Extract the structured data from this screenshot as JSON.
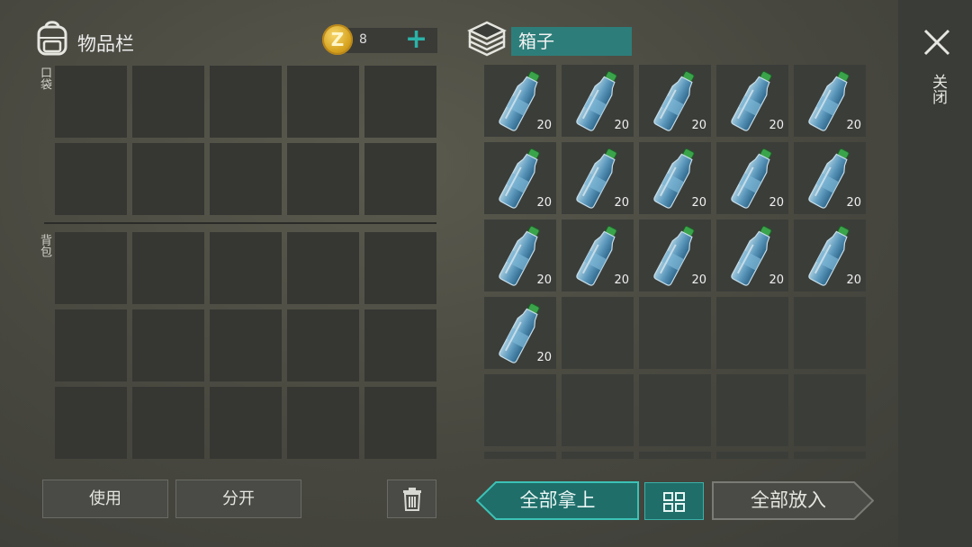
{
  "inventory": {
    "title": "物品栏",
    "pocket_label": "口袋",
    "backpack_label": "背包",
    "coin_icon": "Z",
    "coins": "8",
    "use_label": "使用",
    "split_label": "分开"
  },
  "box": {
    "name": "箱子",
    "item_qty": "20",
    "items": [
      {
        "qty": "20"
      },
      {
        "qty": "20"
      },
      {
        "qty": "20"
      },
      {
        "qty": "20"
      },
      {
        "qty": "20"
      },
      {
        "qty": "20"
      },
      {
        "qty": "20"
      },
      {
        "qty": "20"
      },
      {
        "qty": "20"
      },
      {
        "qty": "20"
      },
      {
        "qty": "20"
      },
      {
        "qty": "20"
      },
      {
        "qty": "20"
      },
      {
        "qty": "20"
      },
      {
        "qty": "20"
      },
      {
        "qty": "20"
      }
    ],
    "take_all_label": "全部拿上",
    "put_all_label": "全部放入"
  },
  "close_label": "关闭",
  "colors": {
    "accent": "#2bb3a8",
    "box_name_bg": "#2d7e7a",
    "slot": "#363733"
  },
  "icons": [
    "backpack-icon",
    "coin-icon",
    "plus-icon",
    "box-stack-icon",
    "water-bottle-icon",
    "trash-icon",
    "sort-grid-icon",
    "close-icon"
  ]
}
